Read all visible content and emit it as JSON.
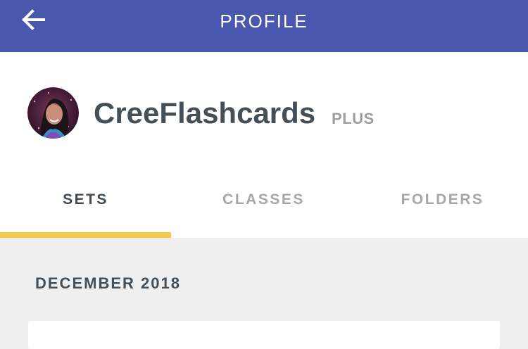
{
  "header": {
    "title": "PROFILE",
    "back_icon": "arrow-left-icon",
    "background_color": "#4a57ae"
  },
  "profile": {
    "username": "CreeFlashcards",
    "tier": "PLUS"
  },
  "tabs": [
    {
      "label": "SETS",
      "active": true
    },
    {
      "label": "CLASSES",
      "active": false
    },
    {
      "label": "FOLDERS",
      "active": false
    }
  ],
  "tab_indicator_color": "#f2c94c",
  "content": {
    "section_heading": "DECEMBER 2018"
  }
}
